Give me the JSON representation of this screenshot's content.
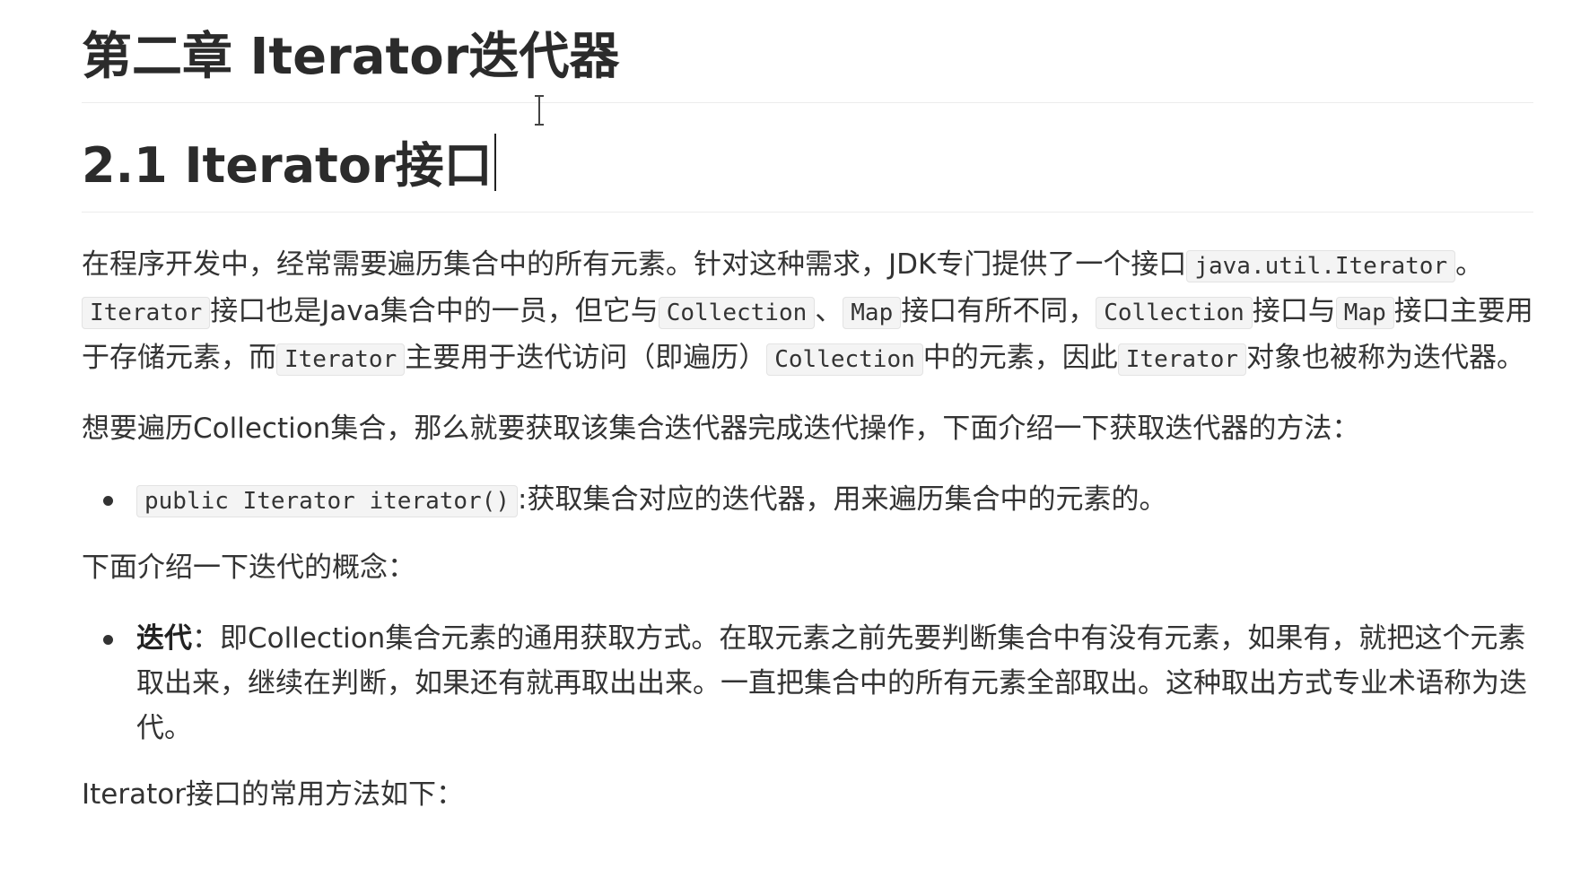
{
  "headings": {
    "chapter": "第二章 Iterator迭代器",
    "section": "2.1 Iterator接口"
  },
  "intro": {
    "t1": "在程序开发中，经常需要遍历集合中的所有元素。针对这种需求，JDK专门提供了一个接口",
    "c1": "java.util.Iterator",
    "t2": "。",
    "c2": "Iterator",
    "t3": "接口也是Java集合中的一员，但它与",
    "c3": "Collection",
    "t4": "、",
    "c4": "Map",
    "t5": "接口有所不同，",
    "c5": "Collection",
    "t6": "接口与",
    "c6": "Map",
    "t7": "接口主要用于存储元素，而",
    "c7": "Iterator",
    "t8": "主要用于迭代访问（即遍历）",
    "c8": "Collection",
    "t9": "中的元素，因此",
    "c9": "Iterator",
    "t10": "对象也被称为迭代器。"
  },
  "want": "想要遍历Collection集合，那么就要获取该集合迭代器完成迭代操作，下面介绍一下获取迭代器的方法：",
  "method_item": {
    "code": "public Iterator iterator()",
    "text": ":获取集合对应的迭代器，用来遍历集合中的元素的。"
  },
  "concept_intro": "下面介绍一下迭代的概念：",
  "concept_item": {
    "term": "迭代",
    "text": "：即Collection集合元素的通用获取方式。在取元素之前先要判断集合中有没有元素，如果有，就把这个元素取出来，继续在判断，如果还有就再取出出来。一直把集合中的所有元素全部取出。这种取出方式专业术语称为迭代。"
  },
  "methods_intro": "Iterator接口的常用方法如下："
}
